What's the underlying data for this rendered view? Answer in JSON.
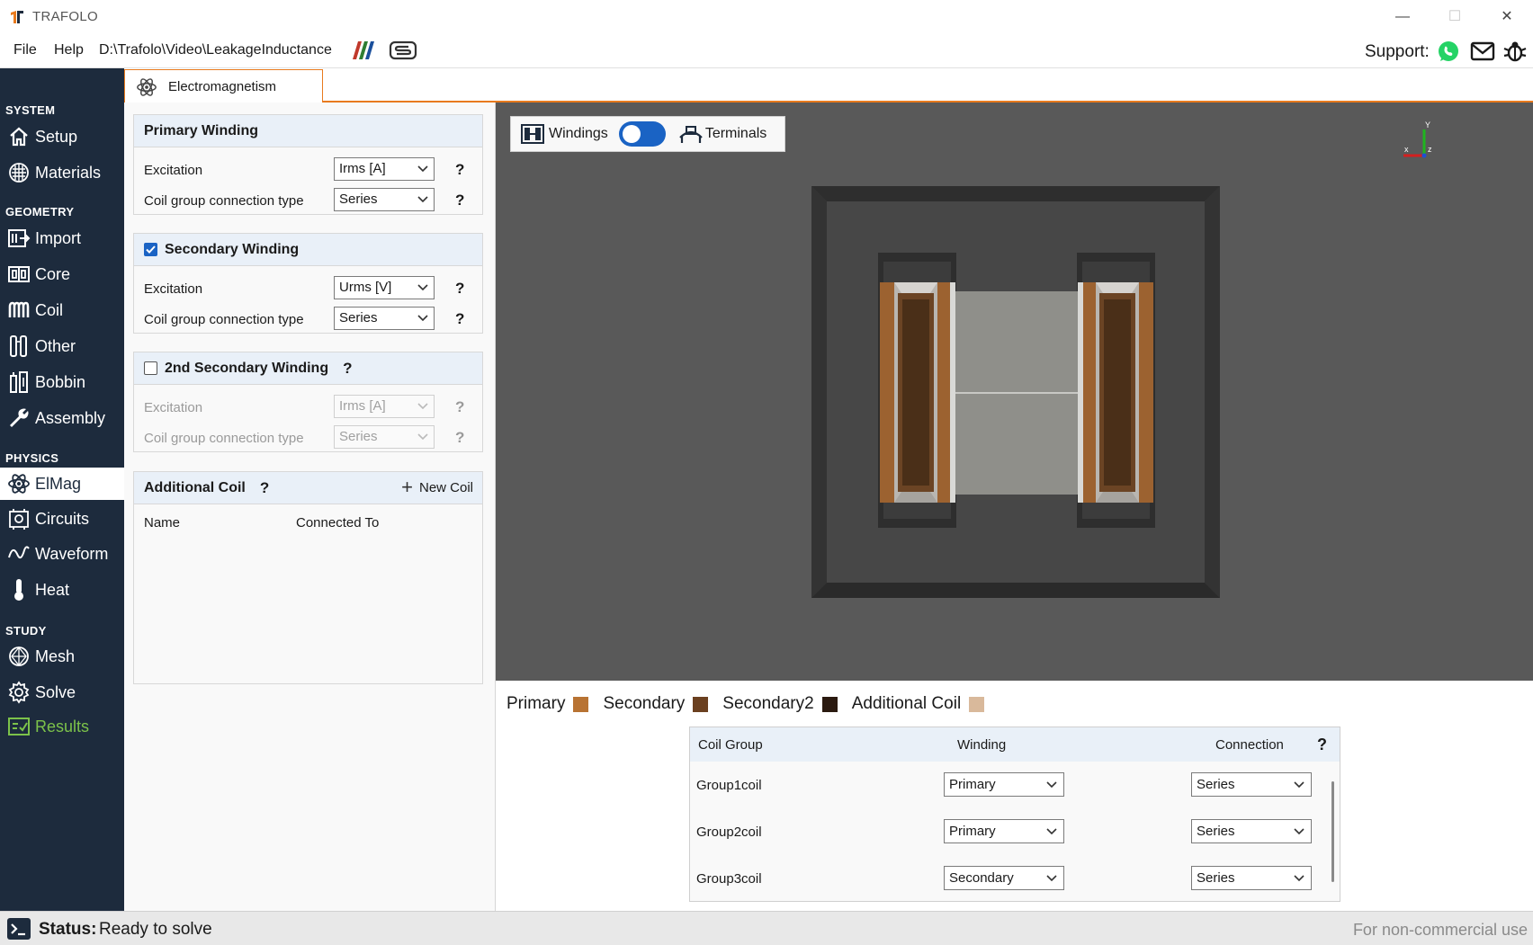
{
  "window": {
    "title": "TRAFOLO"
  },
  "menu": {
    "items": [
      "File",
      "Help"
    ],
    "path": "D:\\Trafolo\\Video\\LeakageInductance",
    "support_label": "Support:"
  },
  "sidebar": {
    "sections": {
      "system": "SYSTEM",
      "geometry": "GEOMETRY",
      "physics": "PHYSICS",
      "study": "STUDY"
    },
    "items": [
      {
        "label": "Setup",
        "icon": "house-icon"
      },
      {
        "label": "Materials",
        "icon": "grid-icon"
      },
      {
        "label": "Import",
        "icon": "import-icon"
      },
      {
        "label": "Core",
        "icon": "core-icon"
      },
      {
        "label": "Coil",
        "icon": "coil-icon"
      },
      {
        "label": "Other",
        "icon": "other-icon"
      },
      {
        "label": "Bobbin",
        "icon": "bobbin-icon"
      },
      {
        "label": "Assembly",
        "icon": "wrench-icon"
      },
      {
        "label": "ElMag",
        "icon": "atom-icon",
        "active": true
      },
      {
        "label": "Circuits",
        "icon": "circuit-icon"
      },
      {
        "label": "Waveform",
        "icon": "waveform-icon"
      },
      {
        "label": "Heat",
        "icon": "thermometer-icon"
      },
      {
        "label": "Mesh",
        "icon": "mesh-icon"
      },
      {
        "label": "Solve",
        "icon": "solve-icon"
      },
      {
        "label": "Results",
        "icon": "results-icon"
      }
    ]
  },
  "tab": {
    "label": "Electromagnetism"
  },
  "primary": {
    "title": "Primary Winding",
    "excitation_label": "Excitation",
    "excitation_value": "Irms [A]",
    "connection_label": "Coil group connection type",
    "connection_value": "Series",
    "help": "?"
  },
  "secondary": {
    "title": "Secondary Winding",
    "checked": true,
    "excitation_label": "Excitation",
    "excitation_value": "Urms [V]",
    "connection_label": "Coil group connection type",
    "connection_value": "Series",
    "help": "?"
  },
  "secondary2": {
    "title": "2nd Secondary Winding",
    "checked": false,
    "excitation_label": "Excitation",
    "excitation_value": "Irms [A]",
    "connection_label": "Coil group connection type",
    "connection_value": "Series",
    "help": "?"
  },
  "additional": {
    "title": "Additional Coil",
    "help": "?",
    "new_coil": "New Coil",
    "col_name": "Name",
    "col_connected": "Connected To"
  },
  "viewport": {
    "windings_label": "Windings",
    "terminals_label": "Terminals",
    "toggle_on": true,
    "axis_x": "x",
    "axis_y": "Y",
    "axis_z": "z"
  },
  "legend": [
    {
      "label": "Primary",
      "color": "#b87333"
    },
    {
      "label": "Secondary",
      "color": "#6b4020"
    },
    {
      "label": "Secondary2",
      "color": "#2b1a10"
    },
    {
      "label": "Additional Coil",
      "color": "#d9b99b"
    }
  ],
  "coil_table": {
    "headers": {
      "group": "Coil Group",
      "winding": "Winding",
      "connection": "Connection",
      "help": "?"
    },
    "rows": [
      {
        "group": "Group1coil",
        "winding": "Primary",
        "connection": "Series"
      },
      {
        "group": "Group2coil",
        "winding": "Primary",
        "connection": "Series"
      },
      {
        "group": "Group3coil",
        "winding": "Secondary",
        "connection": "Series"
      }
    ]
  },
  "status": {
    "label": "Status:",
    "text": "Ready to solve",
    "license": "For non-commercial use"
  },
  "colors": {
    "sidebar_bg": "#1d2b3d",
    "accent_orange": "#e87a1e",
    "accent_blue": "#1a63c4",
    "results_green": "#7cc24a",
    "viewport_bg": "#595959"
  }
}
